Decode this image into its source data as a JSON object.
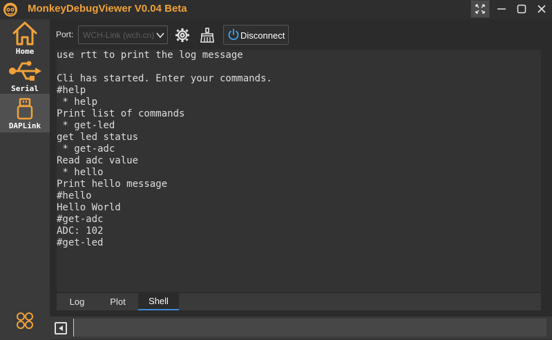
{
  "app": {
    "title": "MonkeyDebugViewer V0.04 Beta"
  },
  "colors": {
    "accent": "#f0a23a",
    "tab_active_underline": "#3c8dde",
    "power_icon": "#3ba7f0"
  },
  "sidebar": {
    "items": [
      {
        "label": "Home",
        "icon": "home-icon"
      },
      {
        "label": "Serial",
        "icon": "usb-icon"
      },
      {
        "label": "DAPLink",
        "icon": "usb-drive-icon"
      }
    ],
    "bottom_icon": "apps-icon"
  },
  "toolbar": {
    "port_label": "Port:",
    "port_value": "WCH-Link (wch.cn)",
    "settings_icon": "gear-icon",
    "clear_icon": "broom-icon",
    "disconnect_label": "Disconnect"
  },
  "console": {
    "lines": [
      "use rtt to print the log message",
      "",
      "Cli has started. Enter your commands.",
      "#help",
      " * help",
      "Print list of commands",
      " * get-led",
      "get led status",
      " * get-adc",
      "Read adc value",
      " * hello",
      "Print hello message",
      "#hello",
      "Hello World",
      "#get-adc",
      "ADC: 102",
      "#get-led"
    ]
  },
  "tabs": [
    {
      "label": "Log"
    },
    {
      "label": "Plot"
    },
    {
      "label": "Shell",
      "active": true
    }
  ],
  "input": {
    "value": ""
  }
}
